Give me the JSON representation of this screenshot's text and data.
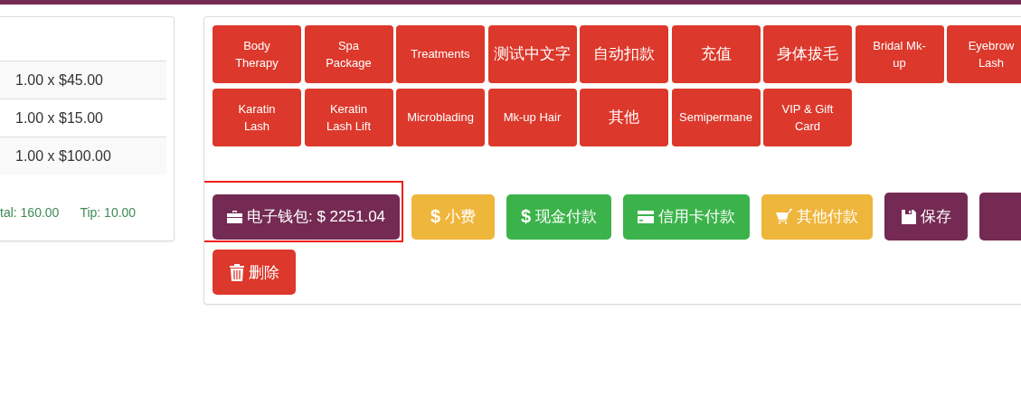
{
  "order_lines": [
    {
      "text": "1.00 x $45.00"
    },
    {
      "text": "1.00 x $15.00"
    },
    {
      "text": "1.00 x $100.00"
    }
  ],
  "totals": {
    "total": "tal: 160.00",
    "tip": "Tip: 10.00"
  },
  "categories": [
    {
      "label": "Body Therapy",
      "kind": "text"
    },
    {
      "label": "Spa Package",
      "kind": "text"
    },
    {
      "label": "Treatments",
      "kind": "text"
    },
    {
      "label": "测试中文字",
      "kind": "cjk"
    },
    {
      "label": "自动扣款",
      "kind": "cjk"
    },
    {
      "label": "充值",
      "kind": "cjk"
    },
    {
      "label": "身体拔毛",
      "kind": "cjk"
    },
    {
      "label": "Bridal Mk-up",
      "kind": "text"
    },
    {
      "label": "Eyebrow Lash",
      "kind": "text"
    },
    {
      "label": "Karatin Lash",
      "kind": "text"
    },
    {
      "label": "Keratin Lash Lift",
      "kind": "text"
    },
    {
      "label": "Microblading",
      "kind": "text"
    },
    {
      "label": "Mk-up Hair",
      "kind": "text"
    },
    {
      "label": "其他",
      "kind": "cjk"
    },
    {
      "label": "Semipermane",
      "kind": "text"
    },
    {
      "label": "VIP & Gift Card",
      "kind": "text"
    }
  ],
  "annotation": {
    "kind": "frame"
  },
  "actions": [
    {
      "label": "电子钱包: $ 2251.04",
      "kind": "wallet",
      "color": "#742a52"
    },
    {
      "label": "小费",
      "kind": "tip",
      "symbol": "$",
      "color": "#efb63c"
    },
    {
      "label": "现金付款",
      "kind": "cash",
      "symbol": "$",
      "color": "#3bb34a"
    },
    {
      "label": "信用卡付款",
      "kind": "credit",
      "color": "#3bb34a"
    },
    {
      "label": "其他付款",
      "kind": "other",
      "color": "#efb63c"
    },
    {
      "label": "保存",
      "kind": "save",
      "color": "#742a52"
    },
    {
      "kind": "blank",
      "color": "#742a52"
    },
    {
      "label": "删除",
      "kind": "delete",
      "color": "#dc382b"
    }
  ]
}
